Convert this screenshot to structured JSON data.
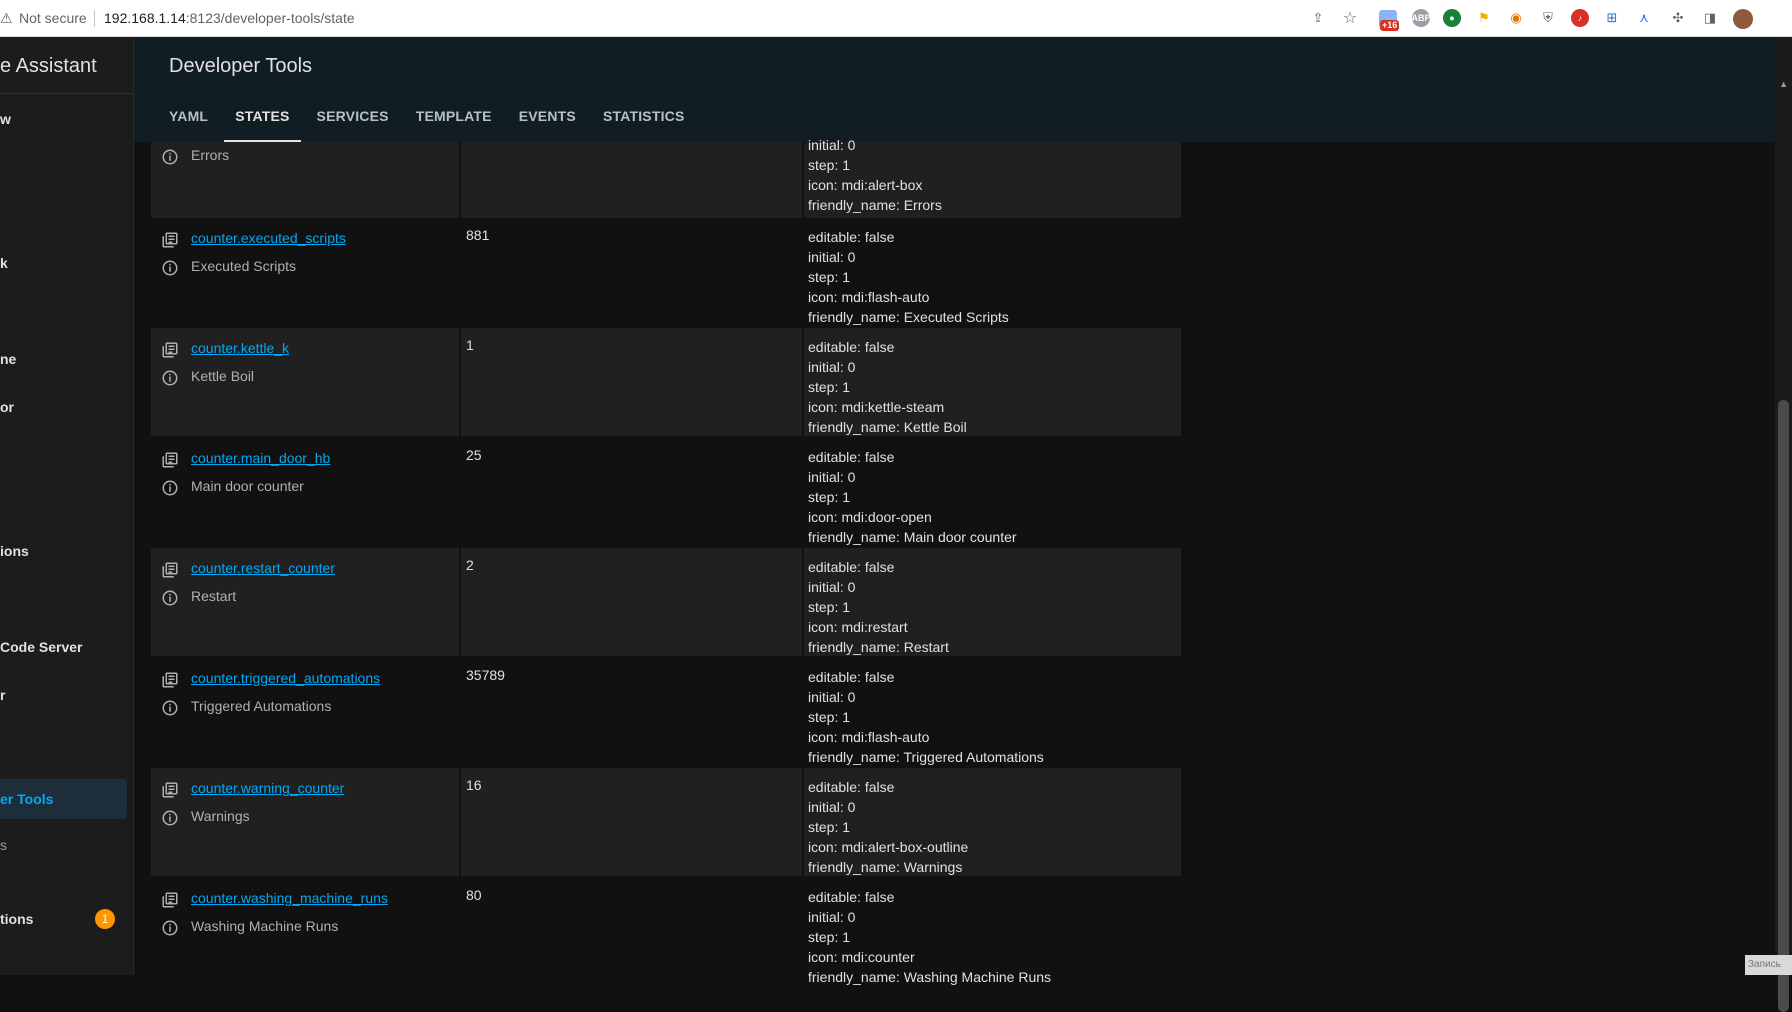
{
  "browser": {
    "not_secure": "Not secure",
    "url_host": "192.168.1.14",
    "url_path": ":8123/developer-tools/state",
    "badge_count": "+16"
  },
  "sidebar": {
    "title": "e Assistant",
    "items": [
      {
        "label": "w"
      },
      {
        "label": "k"
      },
      {
        "label": "ne"
      },
      {
        "label": "or"
      },
      {
        "label": "ions"
      },
      {
        "label": "Code Server"
      },
      {
        "label": "r"
      },
      {
        "label": "er Tools",
        "active": true
      },
      {
        "label": "s"
      },
      {
        "label": "tions",
        "badge": "1"
      }
    ]
  },
  "header": {
    "title": "Developer Tools",
    "tabs": [
      {
        "label": "YAML"
      },
      {
        "label": "STATES",
        "active": true
      },
      {
        "label": "SERVICES"
      },
      {
        "label": "TEMPLATE"
      },
      {
        "label": "EVENTS"
      },
      {
        "label": "STATISTICS"
      }
    ]
  },
  "rows": [
    {
      "entity": "",
      "friendly": "Errors",
      "state": "",
      "attrs": [
        "initial: 0",
        "step: 1",
        "icon: mdi:alert-box",
        "friendly_name: Errors"
      ]
    },
    {
      "entity": "counter.executed_scripts",
      "friendly": "Executed Scripts",
      "state": "881",
      "attrs": [
        "editable: false",
        "initial: 0",
        "step: 1",
        "icon: mdi:flash-auto",
        "friendly_name: Executed Scripts"
      ]
    },
    {
      "entity": "counter.kettle_k",
      "friendly": "Kettle Boil",
      "state": "1",
      "attrs": [
        "editable: false",
        "initial: 0",
        "step: 1",
        "icon: mdi:kettle-steam",
        "friendly_name: Kettle Boil"
      ]
    },
    {
      "entity": "counter.main_door_hb",
      "friendly": "Main door counter",
      "state": "25",
      "attrs": [
        "editable: false",
        "initial: 0",
        "step: 1",
        "icon: mdi:door-open",
        "friendly_name: Main door counter"
      ]
    },
    {
      "entity": "counter.restart_counter",
      "friendly": "Restart",
      "state": "2",
      "attrs": [
        "editable: false",
        "initial: 0",
        "step: 1",
        "icon: mdi:restart",
        "friendly_name: Restart"
      ]
    },
    {
      "entity": "counter.triggered_automations",
      "friendly": "Triggered Automations",
      "state": "35789",
      "attrs": [
        "editable: false",
        "initial: 0",
        "step: 1",
        "icon: mdi:flash-auto",
        "friendly_name: Triggered Automations"
      ]
    },
    {
      "entity": "counter.warning_counter",
      "friendly": "Warnings",
      "state": "16",
      "attrs": [
        "editable: false",
        "initial: 0",
        "step: 1",
        "icon: mdi:alert-box-outline",
        "friendly_name: Warnings"
      ]
    },
    {
      "entity": "counter.washing_machine_runs",
      "friendly": "Washing Machine Runs",
      "state": "80",
      "attrs": [
        "editable: false",
        "initial: 0",
        "step: 1",
        "icon: mdi:counter",
        "friendly_name: Washing Machine Runs"
      ]
    }
  ],
  "corner_note": "Запись",
  "colors": {
    "accent": "#03a9f4",
    "header_bg": "#101e24",
    "row_odd": "#202020",
    "row_even": "#111111",
    "notif_badge": "#ff9800"
  }
}
